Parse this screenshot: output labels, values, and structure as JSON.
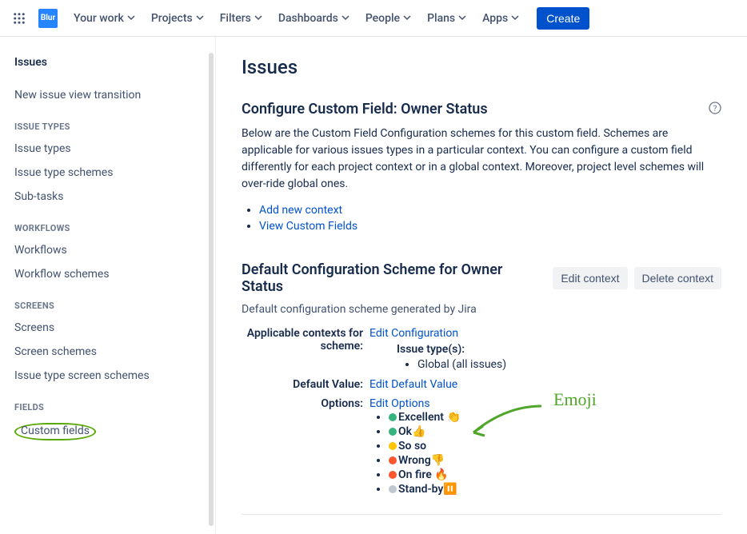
{
  "topnav": {
    "items": [
      "Your work",
      "Projects",
      "Filters",
      "Dashboards",
      "People",
      "Plans",
      "Apps"
    ],
    "create": "Create",
    "logo_text": "Blur"
  },
  "sidebar": {
    "title": "Issues",
    "top_links": [
      "New issue view transition"
    ],
    "groups": [
      {
        "label": "ISSUE TYPES",
        "items": [
          "Issue types",
          "Issue type schemes",
          "Sub-tasks"
        ]
      },
      {
        "label": "WORKFLOWS",
        "items": [
          "Workflows",
          "Workflow schemes"
        ]
      },
      {
        "label": "SCREENS",
        "items": [
          "Screens",
          "Screen schemes",
          "Issue type screen schemes"
        ]
      },
      {
        "label": "FIELDS",
        "items": [
          "Custom fields"
        ]
      }
    ]
  },
  "main": {
    "page_title": "Issues",
    "configure_heading": "Configure Custom Field: Owner Status",
    "configure_desc": "Below are the Custom Field Configuration schemes for this custom field. Schemes are applicable for various issues types in a particular context. You can configure a custom field differently for each project context or in a global context. Moreover, project level schemes will over-ride global ones.",
    "action_links": [
      "Add new context",
      "View Custom Fields"
    ],
    "scheme": {
      "title": "Default Configuration Scheme for Owner Status",
      "edit_btn": "Edit context",
      "delete_btn": "Delete context",
      "subtitle": "Default configuration scheme generated by Jira",
      "rows": {
        "contexts_label": "Applicable contexts for scheme:",
        "contexts_link": "Edit Configuration",
        "issue_types_label": "Issue type(s):",
        "issue_types_value": "Global (all issues)",
        "default_label": "Default Value:",
        "default_link": "Edit Default Value",
        "options_label": "Options:",
        "options_link": "Edit Options"
      },
      "options": [
        {
          "dot": "#36B37E",
          "text": "Excellent 👏"
        },
        {
          "dot": "#36B37E",
          "text": "Ok👍"
        },
        {
          "dot": "#FFC400",
          "text": "So so"
        },
        {
          "dot": "#FF5630",
          "text": "Wrong👎"
        },
        {
          "dot": "#FF5630",
          "text": "On fire 🔥"
        },
        {
          "dot": "#C1C7D0",
          "text": "Stand-by⏸️"
        }
      ]
    },
    "annotation": "Emoji"
  }
}
